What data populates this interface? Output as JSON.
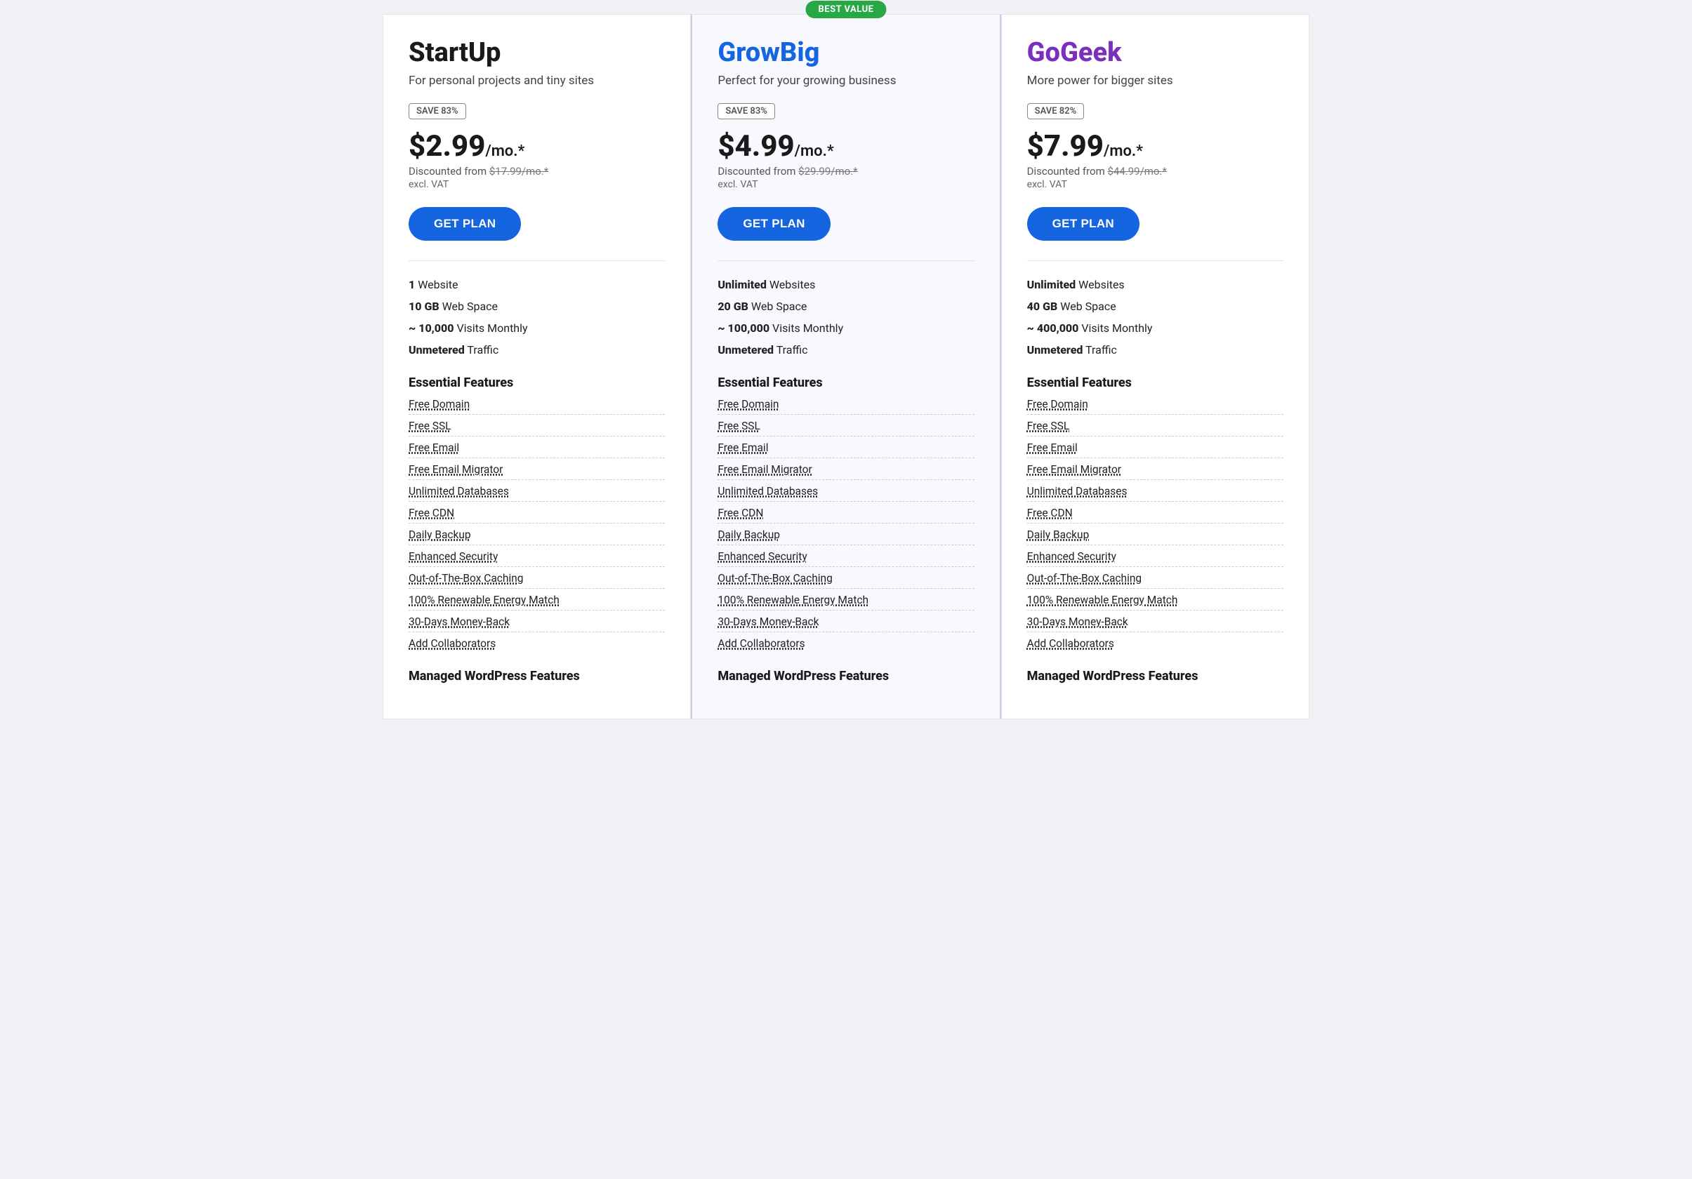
{
  "plans": [
    {
      "id": "startup",
      "name": "StartUp",
      "nameClass": "startup",
      "tagline": "For personal projects and tiny sites",
      "saveBadge": "SAVE 83%",
      "price": "$2.99",
      "priceSuffix": "/mo.*",
      "discountedFrom": "$17.99/mo.*",
      "exclVat": "excl. VAT",
      "btnLabel": "GET PLAN",
      "bestValue": false,
      "specs": [
        {
          "bold": "1",
          "rest": " Website"
        },
        {
          "bold": "10 GB",
          "rest": " Web Space"
        },
        {
          "bold": "~ 10,000",
          "rest": " Visits Monthly"
        },
        {
          "bold": "Unmetered",
          "rest": " Traffic"
        }
      ],
      "essentialTitle": "Essential Features",
      "essentials": [
        "Free Domain",
        "Free SSL",
        "Free Email",
        "Free Email Migrator",
        "Unlimited Databases",
        "Free CDN",
        "Daily Backup",
        "Enhanced Security",
        "Out-of-The-Box Caching",
        "100% Renewable Energy Match",
        "30-Days Money-Back",
        "Add Collaborators"
      ],
      "managedTitle": "Managed WordPress Features"
    },
    {
      "id": "growbig",
      "name": "GrowBig",
      "nameClass": "growbig",
      "tagline": "Perfect for your growing business",
      "saveBadge": "SAVE 83%",
      "price": "$4.99",
      "priceSuffix": "/mo.*",
      "discountedFrom": "$29.99/mo.*",
      "exclVat": "excl. VAT",
      "btnLabel": "GET PLAN",
      "bestValue": true,
      "bestValueLabel": "BEST VALUE",
      "specs": [
        {
          "bold": "Unlimited",
          "rest": " Websites"
        },
        {
          "bold": "20 GB",
          "rest": " Web Space"
        },
        {
          "bold": "~ 100,000",
          "rest": " Visits Monthly"
        },
        {
          "bold": "Unmetered",
          "rest": " Traffic"
        }
      ],
      "essentialTitle": "Essential Features",
      "essentials": [
        "Free Domain",
        "Free SSL",
        "Free Email",
        "Free Email Migrator",
        "Unlimited Databases",
        "Free CDN",
        "Daily Backup",
        "Enhanced Security",
        "Out-of-The-Box Caching",
        "100% Renewable Energy Match",
        "30-Days Money-Back",
        "Add Collaborators"
      ],
      "managedTitle": "Managed WordPress Features"
    },
    {
      "id": "gogeek",
      "name": "GoGeek",
      "nameClass": "gogeek",
      "tagline": "More power for bigger sites",
      "saveBadge": "SAVE 82%",
      "price": "$7.99",
      "priceSuffix": "/mo.*",
      "discountedFrom": "$44.99/mo.*",
      "exclVat": "excl. VAT",
      "btnLabel": "GET PLAN",
      "bestValue": false,
      "specs": [
        {
          "bold": "Unlimited",
          "rest": " Websites"
        },
        {
          "bold": "40 GB",
          "rest": " Web Space"
        },
        {
          "bold": "~ 400,000",
          "rest": " Visits Monthly"
        },
        {
          "bold": "Unmetered",
          "rest": " Traffic"
        }
      ],
      "essentialTitle": "Essential Features",
      "essentials": [
        "Free Domain",
        "Free SSL",
        "Free Email",
        "Free Email Migrator",
        "Unlimited Databases",
        "Free CDN",
        "Daily Backup",
        "Enhanced Security",
        "Out-of-The-Box Caching",
        "100% Renewable Energy Match",
        "30-Days Money-Back",
        "Add Collaborators"
      ],
      "managedTitle": "Managed WordPress Features"
    }
  ]
}
